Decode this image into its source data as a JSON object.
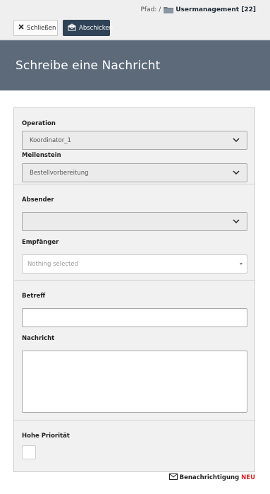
{
  "breadcrumb": {
    "prefix": "Pfad: /",
    "current": "Usermanagement [22]"
  },
  "toolbar": {
    "close_label": "Schließen",
    "send_label": "Abschicken"
  },
  "header": {
    "title": "Schreibe eine Nachricht"
  },
  "form": {
    "operation": {
      "label": "Operation",
      "value": "Koordinator_1"
    },
    "milestone": {
      "label": "Meilenstein",
      "value": "Bestellvorbereitung"
    },
    "sender": {
      "label": "Absender",
      "value": ""
    },
    "recipient": {
      "label": "Empfänger",
      "placeholder": "Nothing selected"
    },
    "subject": {
      "label": "Betreff",
      "value": ""
    },
    "message": {
      "label": "Nachricht",
      "value": ""
    },
    "priority": {
      "label": "Hohe Priorität",
      "checked": false
    }
  },
  "footer": {
    "notify_label": "Benachrichtigung",
    "new_badge": "NEU"
  },
  "colors": {
    "header_band": "#5c6a7a",
    "primary_button": "#2f4256",
    "new_badge": "#d42020"
  },
  "icons": [
    "folder-icon",
    "close-icon",
    "send-icon",
    "chevron-down-icon",
    "caret-down-icon",
    "mail-icon"
  ]
}
